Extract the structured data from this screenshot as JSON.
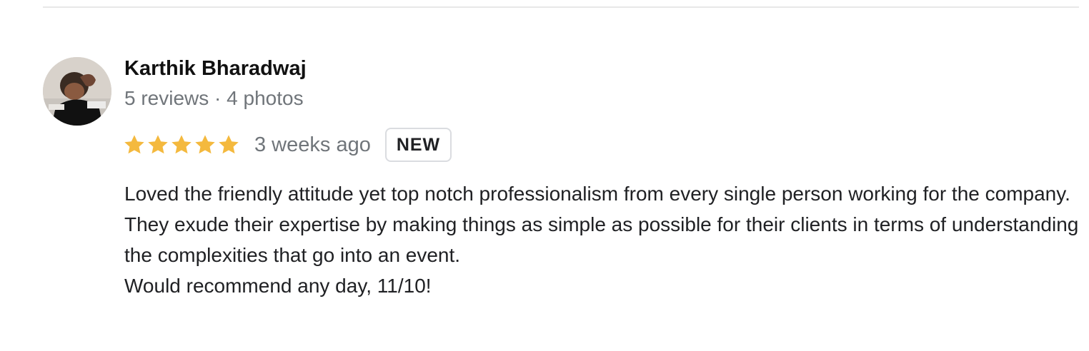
{
  "review": {
    "reviewer_name": "Karthik Bharadwaj",
    "reviewer_meta": "5 reviews · 4 photos",
    "rating": 5,
    "rating_max": 5,
    "time_ago": "3 weeks ago",
    "badge": "NEW",
    "text_lines": [
      "Loved the friendly attitude yet top notch professionalism from every single person working for the company.",
      "They exude their expertise by making things as simple as possible for their clients in terms of understanding the complexities that go into an event.",
      "Would recommend any day, 11/10!"
    ]
  },
  "icons": {
    "star": "star-icon",
    "avatar": "profile-photo"
  },
  "colors": {
    "star": "#f4b93e",
    "secondary_text": "#70757a",
    "primary_text": "#202124",
    "divider": "#e8e8e8"
  }
}
